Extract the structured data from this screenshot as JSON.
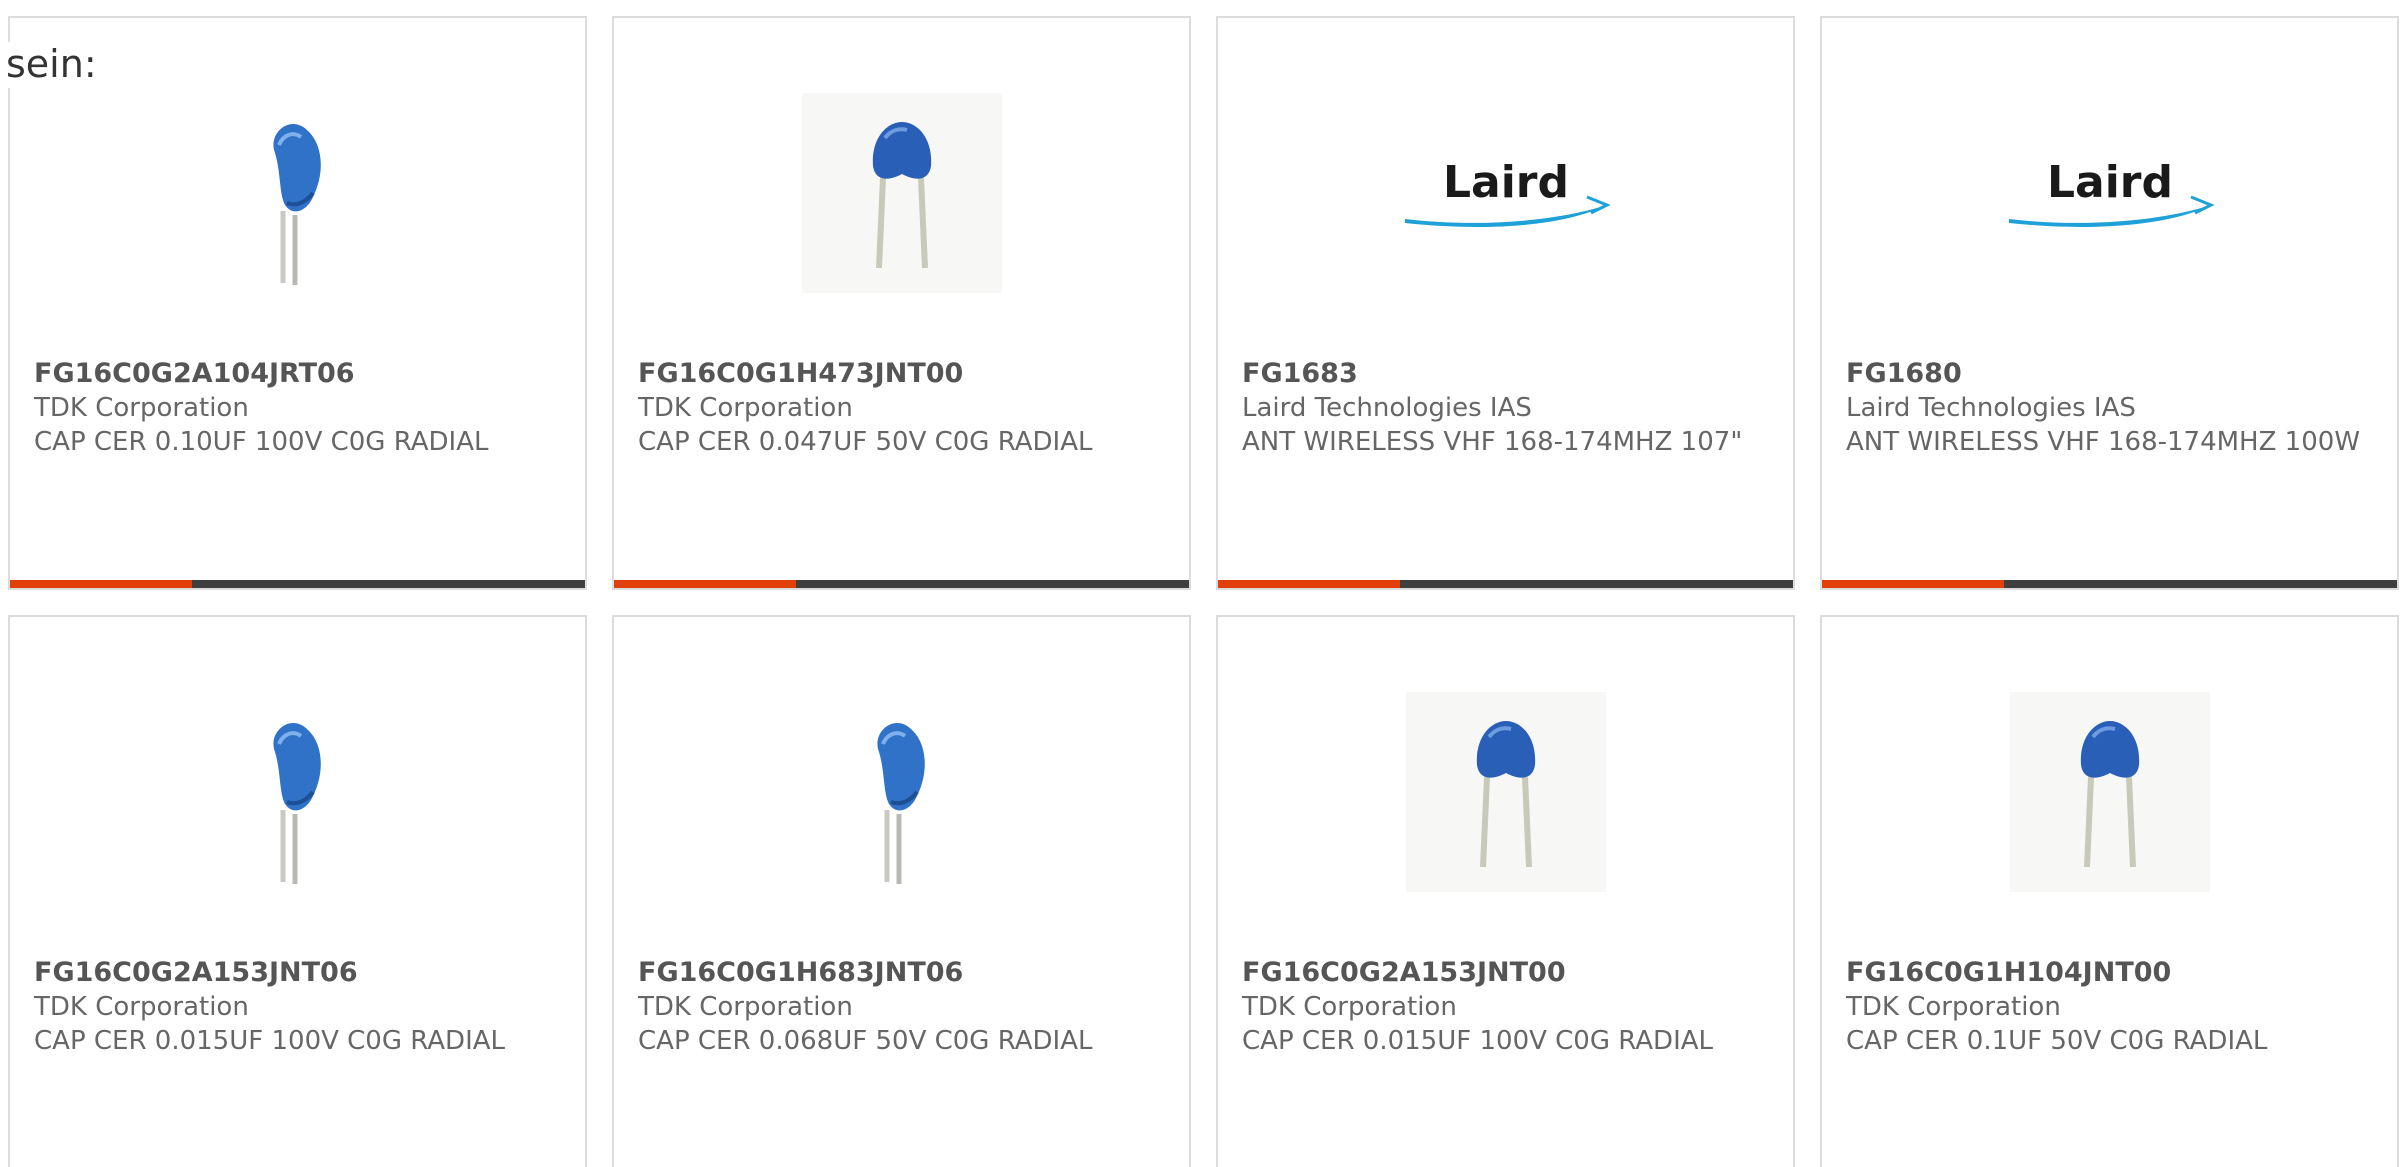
{
  "intro_text": "sein:",
  "colors": {
    "accent": "#e2400b",
    "bar": "#3f3f3f",
    "border": "#dcdcdc",
    "part_text": "#555555",
    "body_text": "#666666",
    "capacitor_blue": "#2d6fc4",
    "laird_blue": "#1ea0d8"
  },
  "products": [
    {
      "part_number": "FG16C0G2A104JRT06",
      "manufacturer": "TDK Corporation",
      "description": "CAP CER 0.10UF 100V C0G RADIAL",
      "image": "capacitor-side-icon"
    },
    {
      "part_number": "FG16C0G1H473JNT00",
      "manufacturer": "TDK Corporation",
      "description": "CAP CER 0.047UF 50V C0G RADIAL",
      "image": "capacitor-front-icon"
    },
    {
      "part_number": "FG1683",
      "manufacturer": "Laird Technologies IAS",
      "description": "ANT WIRELESS VHF 168-174MHZ 107\"",
      "image": "laird-logo",
      "logo_text": "Laird"
    },
    {
      "part_number": "FG1680",
      "manufacturer": "Laird Technologies IAS",
      "description": "ANT WIRELESS VHF 168-174MHZ 100W",
      "image": "laird-logo",
      "logo_text": "Laird"
    },
    {
      "part_number": "FG16C0G2A153JNT06",
      "manufacturer": "TDK Corporation",
      "description": "CAP CER 0.015UF 100V C0G RADIAL",
      "image": "capacitor-side-icon"
    },
    {
      "part_number": "FG16C0G1H683JNT06",
      "manufacturer": "TDK Corporation",
      "description": "CAP CER 0.068UF 50V C0G RADIAL",
      "image": "capacitor-side-icon"
    },
    {
      "part_number": "FG16C0G2A153JNT00",
      "manufacturer": "TDK Corporation",
      "description": "CAP CER 0.015UF 100V C0G RADIAL",
      "image": "capacitor-front-icon"
    },
    {
      "part_number": "FG16C0G1H104JNT00",
      "manufacturer": "TDK Corporation",
      "description": "CAP CER 0.1UF 50V C0G RADIAL",
      "image": "capacitor-front-icon"
    }
  ]
}
